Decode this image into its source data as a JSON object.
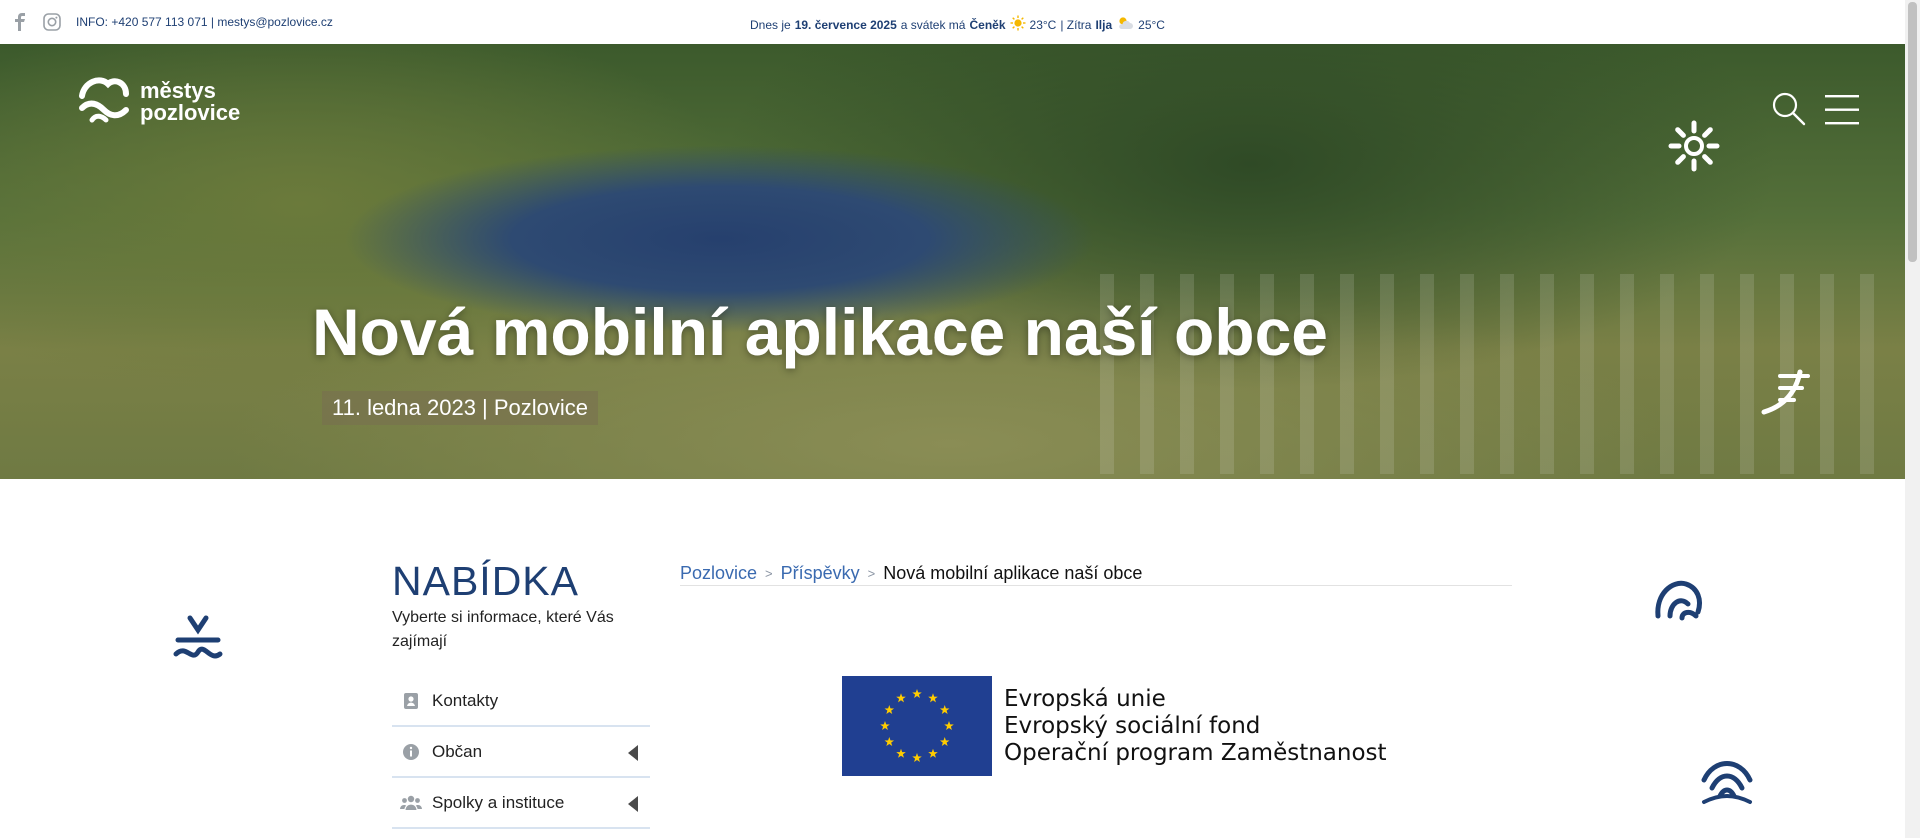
{
  "topbar": {
    "info": "INFO: +420 577 113 071 | mestys@pozlovice.cz",
    "weather": {
      "prefix": "Dnes je",
      "date": "19. července 2025",
      "mid": "a svátek má",
      "name_today": "Čeněk",
      "temp_today": "23°C",
      "sep": "| Zítra",
      "name_tomorrow": "Ilja",
      "temp_tomorrow": "25°C"
    }
  },
  "hero": {
    "logo_line1": "městys",
    "logo_line2": "pozlovice",
    "title": "Nová mobilní aplikace naší obce",
    "meta": "11. ledna 2023 | Pozlovice"
  },
  "menu": {
    "title": "NABÍDKA",
    "subtitle": "Vyberte si informace, které Vás zajímají",
    "items": [
      {
        "label": "Kontakty",
        "icon": "contact-card-icon",
        "has_submenu": false
      },
      {
        "label": "Občan",
        "icon": "info-icon",
        "has_submenu": true
      },
      {
        "label": "Spolky a instituce",
        "icon": "users-icon",
        "has_submenu": true
      }
    ]
  },
  "breadcrumb": {
    "items": [
      "Pozlovice",
      "Příspěvky"
    ],
    "separator": ">",
    "current": "Nová mobilní aplikace naší obce"
  },
  "eu_logo": {
    "line1": "Evropská unie",
    "line2": "Evropský sociální fond",
    "line3": "Operační program Zaměstnanost"
  },
  "colors": {
    "brand_blue": "#1e3f73",
    "link_blue": "#3a6ab0",
    "eu_blue": "#203f91",
    "eu_star": "#ffcc00"
  }
}
